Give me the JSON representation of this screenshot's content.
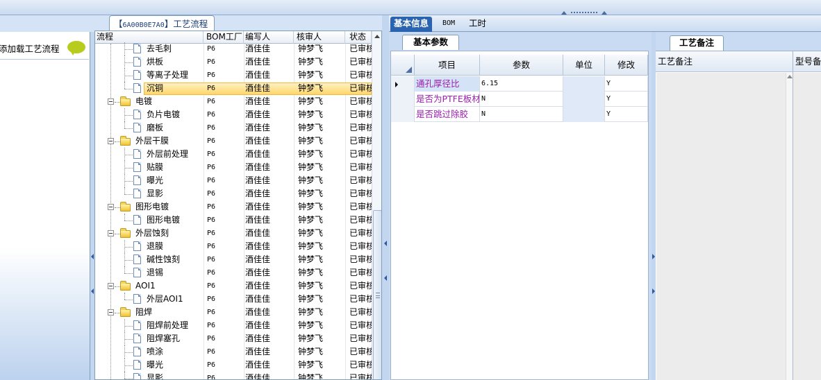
{
  "left_panel": {
    "item_label": "添加载工艺流程"
  },
  "tree_tab": {
    "code": "6A00B0E7A0",
    "title": "工艺流程"
  },
  "tree": {
    "columns": [
      "流程",
      "BOM工厂",
      "编写人",
      "核审人",
      "状态"
    ],
    "rows": [
      {
        "level": 2,
        "folder": false,
        "label": "去毛刺",
        "factory": "P6",
        "author": "酒佳佳",
        "reviewer": "钟梦飞",
        "status": "已审核"
      },
      {
        "level": 2,
        "folder": false,
        "label": "烘板",
        "factory": "P6",
        "author": "酒佳佳",
        "reviewer": "钟梦飞",
        "status": "已审核"
      },
      {
        "level": 2,
        "folder": false,
        "label": "等离子处理",
        "factory": "P6",
        "author": "酒佳佳",
        "reviewer": "钟梦飞",
        "status": "已审核"
      },
      {
        "level": 2,
        "folder": false,
        "label": "沉铜",
        "factory": "P6",
        "author": "酒佳佳",
        "reviewer": "钟梦飞",
        "status": "已审核",
        "selected": true
      },
      {
        "level": 1,
        "folder": true,
        "label": "电镀",
        "factory": "P6",
        "author": "酒佳佳",
        "reviewer": "钟梦飞",
        "status": "已审核"
      },
      {
        "level": 2,
        "folder": false,
        "label": "负片电镀",
        "factory": "P6",
        "author": "酒佳佳",
        "reviewer": "钟梦飞",
        "status": "已审核"
      },
      {
        "level": 2,
        "folder": false,
        "label": "磨板",
        "factory": "P6",
        "author": "酒佳佳",
        "reviewer": "钟梦飞",
        "status": "已审核"
      },
      {
        "level": 1,
        "folder": true,
        "label": "外层干膜",
        "factory": "P6",
        "author": "酒佳佳",
        "reviewer": "钟梦飞",
        "status": "已审核"
      },
      {
        "level": 2,
        "folder": false,
        "label": "外层前处理",
        "factory": "P6",
        "author": "酒佳佳",
        "reviewer": "钟梦飞",
        "status": "已审核"
      },
      {
        "level": 2,
        "folder": false,
        "label": "贴膜",
        "factory": "P6",
        "author": "酒佳佳",
        "reviewer": "钟梦飞",
        "status": "已审核"
      },
      {
        "level": 2,
        "folder": false,
        "label": "曝光",
        "factory": "P6",
        "author": "酒佳佳",
        "reviewer": "钟梦飞",
        "status": "已审核"
      },
      {
        "level": 2,
        "folder": false,
        "label": "显影",
        "factory": "P6",
        "author": "酒佳佳",
        "reviewer": "钟梦飞",
        "status": "已审核"
      },
      {
        "level": 1,
        "folder": true,
        "label": "图形电镀",
        "factory": "P6",
        "author": "酒佳佳",
        "reviewer": "钟梦飞",
        "status": "已审核"
      },
      {
        "level": 2,
        "folder": false,
        "label": "图形电镀",
        "factory": "P6",
        "author": "酒佳佳",
        "reviewer": "钟梦飞",
        "status": "已审核"
      },
      {
        "level": 1,
        "folder": true,
        "label": "外层蚀刻",
        "factory": "P6",
        "author": "酒佳佳",
        "reviewer": "钟梦飞",
        "status": "已审核"
      },
      {
        "level": 2,
        "folder": false,
        "label": "退膜",
        "factory": "P6",
        "author": "酒佳佳",
        "reviewer": "钟梦飞",
        "status": "已审核"
      },
      {
        "level": 2,
        "folder": false,
        "label": "碱性蚀刻",
        "factory": "P6",
        "author": "酒佳佳",
        "reviewer": "钟梦飞",
        "status": "已审核"
      },
      {
        "level": 2,
        "folder": false,
        "label": "退锡",
        "factory": "P6",
        "author": "酒佳佳",
        "reviewer": "钟梦飞",
        "status": "已审核"
      },
      {
        "level": 1,
        "folder": true,
        "label": "AOI1",
        "factory": "P6",
        "author": "酒佳佳",
        "reviewer": "钟梦飞",
        "status": "已审核"
      },
      {
        "level": 2,
        "folder": false,
        "label": "外层AOI1",
        "factory": "P6",
        "author": "酒佳佳",
        "reviewer": "钟梦飞",
        "status": "已审核"
      },
      {
        "level": 1,
        "folder": true,
        "label": "阻焊",
        "factory": "P6",
        "author": "酒佳佳",
        "reviewer": "钟梦飞",
        "status": "已审核"
      },
      {
        "level": 2,
        "folder": false,
        "label": "阻焊前处理",
        "factory": "P6",
        "author": "酒佳佳",
        "reviewer": "钟梦飞",
        "status": "已审核"
      },
      {
        "level": 2,
        "folder": false,
        "label": "阻焊塞孔",
        "factory": "P6",
        "author": "酒佳佳",
        "reviewer": "钟梦飞",
        "status": "已审核"
      },
      {
        "level": 2,
        "folder": false,
        "label": "喷涂",
        "factory": "P6",
        "author": "酒佳佳",
        "reviewer": "钟梦飞",
        "status": "已审核"
      },
      {
        "level": 2,
        "folder": false,
        "label": "曝光",
        "factory": "P6",
        "author": "酒佳佳",
        "reviewer": "钟梦飞",
        "status": "已审核"
      },
      {
        "level": 2,
        "folder": false,
        "label": "显影",
        "factory": "P6",
        "author": "酒佳佳",
        "reviewer": "钟梦飞",
        "status": "已审核"
      }
    ]
  },
  "right_tabs": [
    "基本信息",
    "BOM",
    "工时"
  ],
  "params": {
    "tab": "基本参数",
    "columns": [
      "项目",
      "参数",
      "单位",
      "修改"
    ],
    "rows": [
      {
        "item": "通孔厚径比",
        "value": "6.15",
        "unit": "",
        "modified": "Y"
      },
      {
        "item": "是否为PTFE板材",
        "value": "N",
        "unit": "",
        "modified": "Y"
      },
      {
        "item": "是否跳过除胶",
        "value": "N",
        "unit": "",
        "modified": "Y"
      }
    ]
  },
  "notes": {
    "tab": "工艺备注",
    "col1": "工艺备注",
    "col2": "型号备注"
  },
  "colors": {
    "accent": "#2a64b0",
    "selection": "#ffd66b",
    "param_label": "#9b1fae"
  }
}
